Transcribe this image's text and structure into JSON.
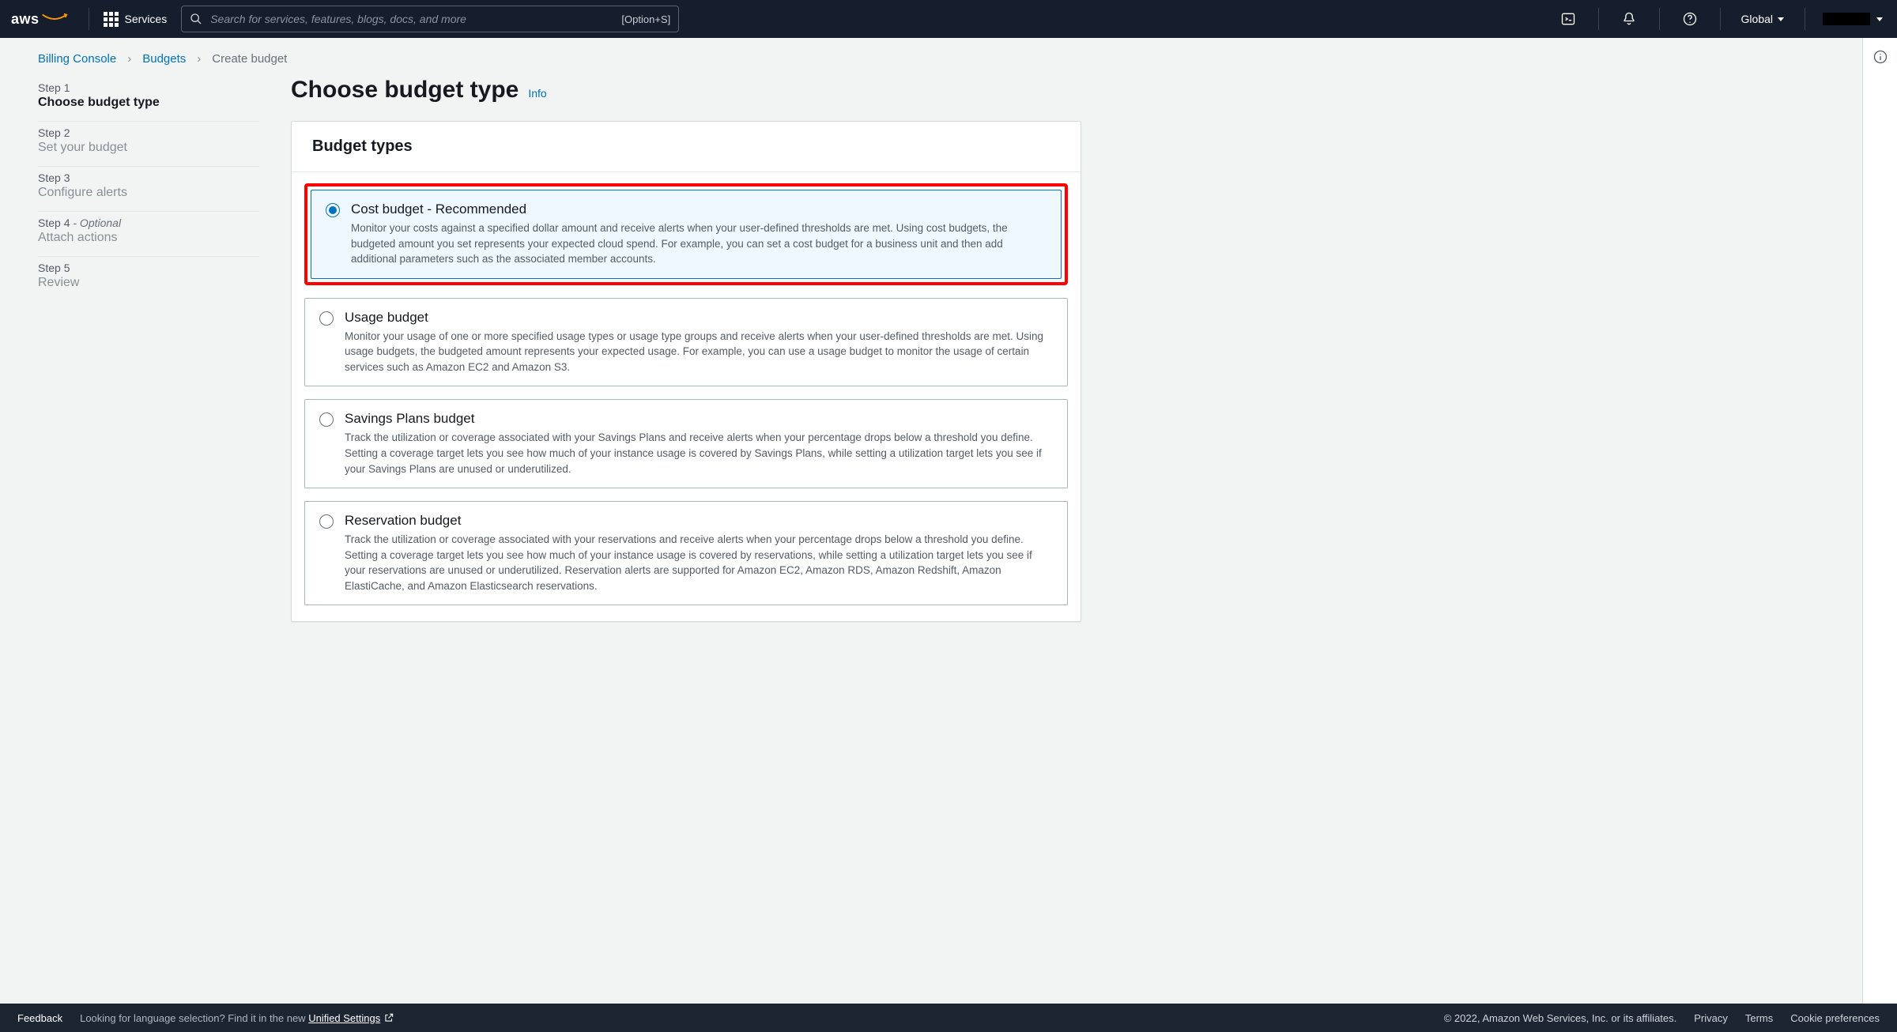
{
  "nav": {
    "logo_text": "aws",
    "services_label": "Services",
    "search_placeholder": "Search for services, features, blogs, docs, and more",
    "search_shortcut": "[Option+S]",
    "region": "Global"
  },
  "breadcrumbs": {
    "billing": "Billing Console",
    "budgets": "Budgets",
    "current": "Create budget"
  },
  "steps": [
    {
      "label": "Step 1",
      "title": "Choose budget type",
      "optional": false,
      "active": true
    },
    {
      "label": "Step 2",
      "title": "Set your budget",
      "optional": false,
      "active": false
    },
    {
      "label": "Step 3",
      "title": "Configure alerts",
      "optional": false,
      "active": false
    },
    {
      "label": "Step 4",
      "title": "Attach actions",
      "optional": true,
      "active": false
    },
    {
      "label": "Step 5",
      "title": "Review",
      "optional": false,
      "active": false
    }
  ],
  "page": {
    "title": "Choose budget type",
    "info": "Info",
    "panel_header": "Budget types"
  },
  "options": [
    {
      "title": "Cost budget - Recommended",
      "desc": "Monitor your costs against a specified dollar amount and receive alerts when your user-defined thresholds are met. Using cost budgets, the budgeted amount you set represents your expected cloud spend. For example, you can set a cost budget for a business unit and then add additional parameters such as the associated member accounts.",
      "selected": true,
      "highlighted": true
    },
    {
      "title": "Usage budget",
      "desc": "Monitor your usage of one or more specified usage types or usage type groups and receive alerts when your user-defined thresholds are met. Using usage budgets, the budgeted amount represents your expected usage. For example, you can use a usage budget to monitor the usage of certain services such as Amazon EC2 and Amazon S3.",
      "selected": false,
      "highlighted": false
    },
    {
      "title": "Savings Plans budget",
      "desc": "Track the utilization or coverage associated with your Savings Plans and receive alerts when your percentage drops below a threshold you define. Setting a coverage target lets you see how much of your instance usage is covered by Savings Plans, while setting a utilization target lets you see if your Savings Plans are unused or underutilized.",
      "selected": false,
      "highlighted": false
    },
    {
      "title": "Reservation budget",
      "desc": "Track the utilization or coverage associated with your reservations and receive alerts when your percentage drops below a threshold you define. Setting a coverage target lets you see how much of your instance usage is covered by reservations, while setting a utilization target lets you see if your reservations are unused or underutilized. Reservation alerts are supported for Amazon EC2, Amazon RDS, Amazon Redshift, Amazon ElastiCache, and Amazon Elasticsearch reservations.",
      "selected": false,
      "highlighted": false
    }
  ],
  "footer": {
    "feedback": "Feedback",
    "lang_msg": "Looking for language selection? Find it in the new ",
    "unified": "Unified Settings",
    "copyright": "© 2022, Amazon Web Services, Inc. or its affiliates.",
    "privacy": "Privacy",
    "terms": "Terms",
    "cookies": "Cookie preferences"
  },
  "optional_word": "Optional"
}
